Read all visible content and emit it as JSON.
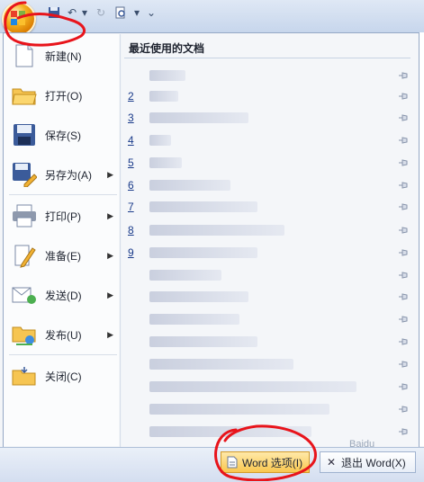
{
  "menu": {
    "items": [
      {
        "label": "新建(N)",
        "has_arrow": false,
        "icon": "new-document-icon"
      },
      {
        "label": "打开(O)",
        "has_arrow": false,
        "icon": "open-folder-icon"
      },
      {
        "label": "保存(S)",
        "has_arrow": false,
        "icon": "save-icon"
      },
      {
        "label": "另存为(A)",
        "has_arrow": true,
        "icon": "save-as-icon"
      },
      {
        "label": "打印(P)",
        "has_arrow": true,
        "icon": "print-icon"
      },
      {
        "label": "准备(E)",
        "has_arrow": true,
        "icon": "prepare-icon"
      },
      {
        "label": "发送(D)",
        "has_arrow": true,
        "icon": "send-icon"
      },
      {
        "label": "发布(U)",
        "has_arrow": true,
        "icon": "publish-icon"
      },
      {
        "label": "关闭(C)",
        "has_arrow": false,
        "icon": "close-folder-icon"
      }
    ]
  },
  "recent": {
    "title": "最近使用的文档",
    "numbers": [
      "2",
      "3",
      "4",
      "5",
      "6",
      "7",
      "8",
      "9"
    ]
  },
  "bottom": {
    "options_label": "Word 选项(I)",
    "exit_label": "退出 Word(X)"
  },
  "colors": {
    "annotation": "#e8141b",
    "accent": "#f4b11f"
  }
}
